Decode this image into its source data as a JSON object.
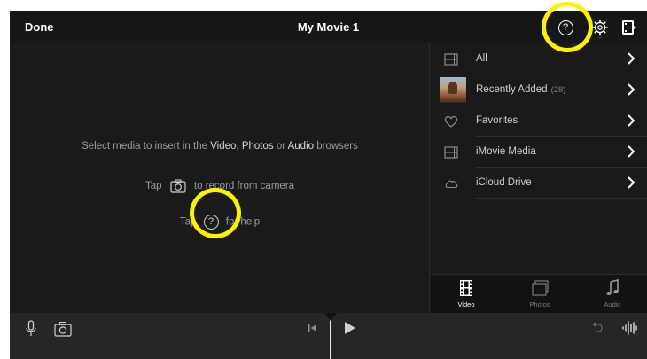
{
  "topbar": {
    "done_label": "Done",
    "title": "My Movie 1",
    "icons": [
      "help-icon",
      "settings-gear-icon",
      "project-settings-icon"
    ]
  },
  "viewer": {
    "select_prefix": "Select media to insert in the ",
    "video_word": "Video",
    "comma": ", ",
    "photos_word": "Photos",
    "or_word": " or ",
    "audio_word": "Audio",
    "select_suffix": " browsers",
    "tap_prefix": "Tap",
    "record_suffix": "to record from camera",
    "help_prefix": "Tap",
    "help_suffix": "for help",
    "help_glyph": "?"
  },
  "browser": {
    "items": [
      {
        "label": "All",
        "count": "",
        "icon": "film-icon"
      },
      {
        "label": "Recently Added",
        "count": "(28)",
        "icon": "thumbnail"
      },
      {
        "label": "Favorites",
        "count": "",
        "icon": "heart-icon"
      },
      {
        "label": "iMovie Media",
        "count": "",
        "icon": "film-icon"
      },
      {
        "label": "iCloud Drive",
        "count": "",
        "icon": "cloud-icon"
      }
    ],
    "tabs": [
      {
        "label": "Video",
        "icon": "film-strip-icon",
        "active": true
      },
      {
        "label": "Photos",
        "icon": "photos-icon",
        "active": false
      },
      {
        "label": "Audio",
        "icon": "music-note-icon",
        "active": false
      }
    ]
  },
  "topbar_help_glyph": "?",
  "colors": {
    "background": "#1d1d1d",
    "topbar": "#161616",
    "highlight": "#fff200",
    "text_dim": "#9a9a9a",
    "tab_active": "#ffffff",
    "tab_inactive": "#7a7a7a"
  }
}
